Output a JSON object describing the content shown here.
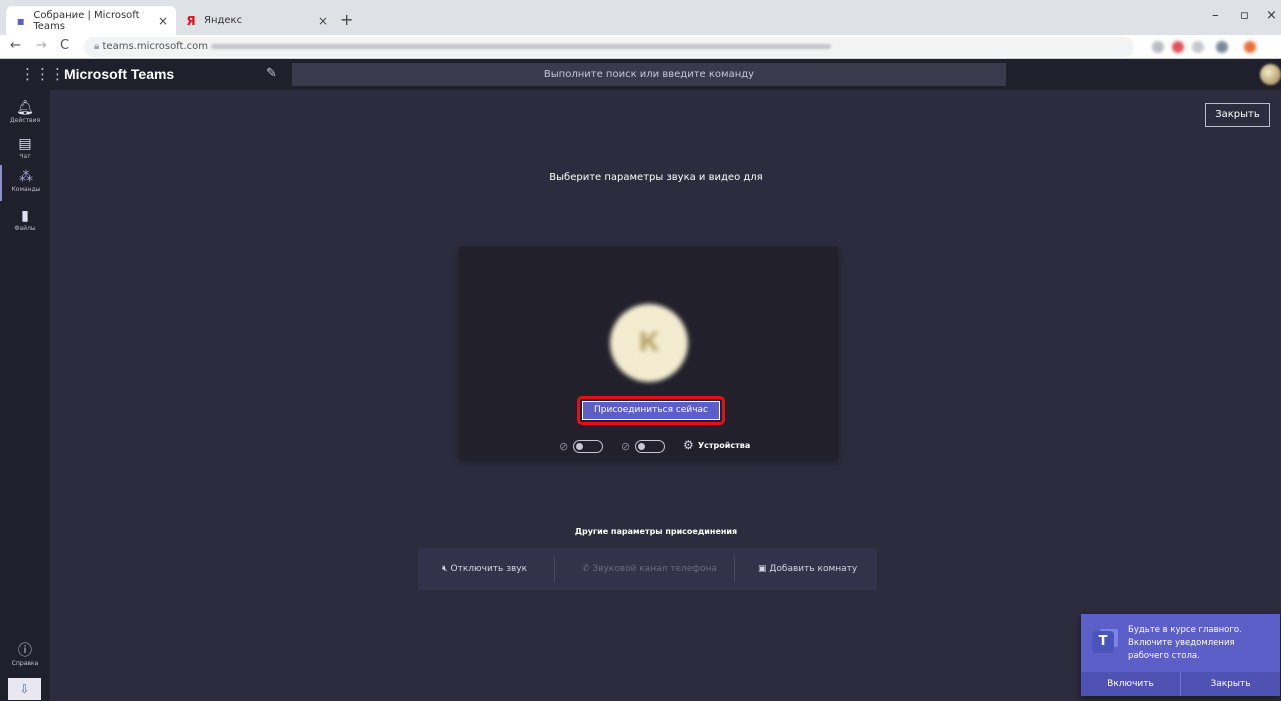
{
  "browser": {
    "tabs": [
      {
        "title": "Собрание | Microsoft Teams",
        "active": true
      },
      {
        "title": "Яндекс",
        "active": false
      }
    ],
    "new_tab_icon": "plus-icon",
    "favicon_yandex": "Я",
    "url_visible": "teams.microsoft.com"
  },
  "teams_header": {
    "app_title": "Microsoft Teams",
    "search_placeholder": "Выполните поиск или введите команду"
  },
  "rail": {
    "items": [
      {
        "label": "Действия",
        "icon": "bell-icon"
      },
      {
        "label": "Чат",
        "icon": "chat-icon"
      },
      {
        "label": "Команды",
        "icon": "teams-icon",
        "active": true
      },
      {
        "label": "Файлы",
        "icon": "file-icon"
      }
    ],
    "help_label": "Справка"
  },
  "main": {
    "close_label": "Закрыть",
    "prompt": "Выберите параметры звука и видео для",
    "avatar_initial": "К",
    "join_label": "Присоединиться сейчас",
    "devices_label": "Устройства",
    "other_title": "Другие параметры присоединения",
    "options": [
      {
        "label": "Отключить звук",
        "icon": "speaker-muted-icon",
        "enabled": true
      },
      {
        "label": "Звуковой канал телефона",
        "icon": "phone-icon",
        "enabled": false
      },
      {
        "label": "Добавить комнату",
        "icon": "room-icon",
        "enabled": true
      }
    ]
  },
  "toast": {
    "text": "Будьте в курсе главного. Включите уведомления рабочего стола.",
    "enable_label": "Включить",
    "close_label": "Закрыть"
  },
  "colors": {
    "background": "#2d2c3e",
    "rail": "#201f2c",
    "accent": "#5b5fc7",
    "highlight": "#e0111b"
  }
}
